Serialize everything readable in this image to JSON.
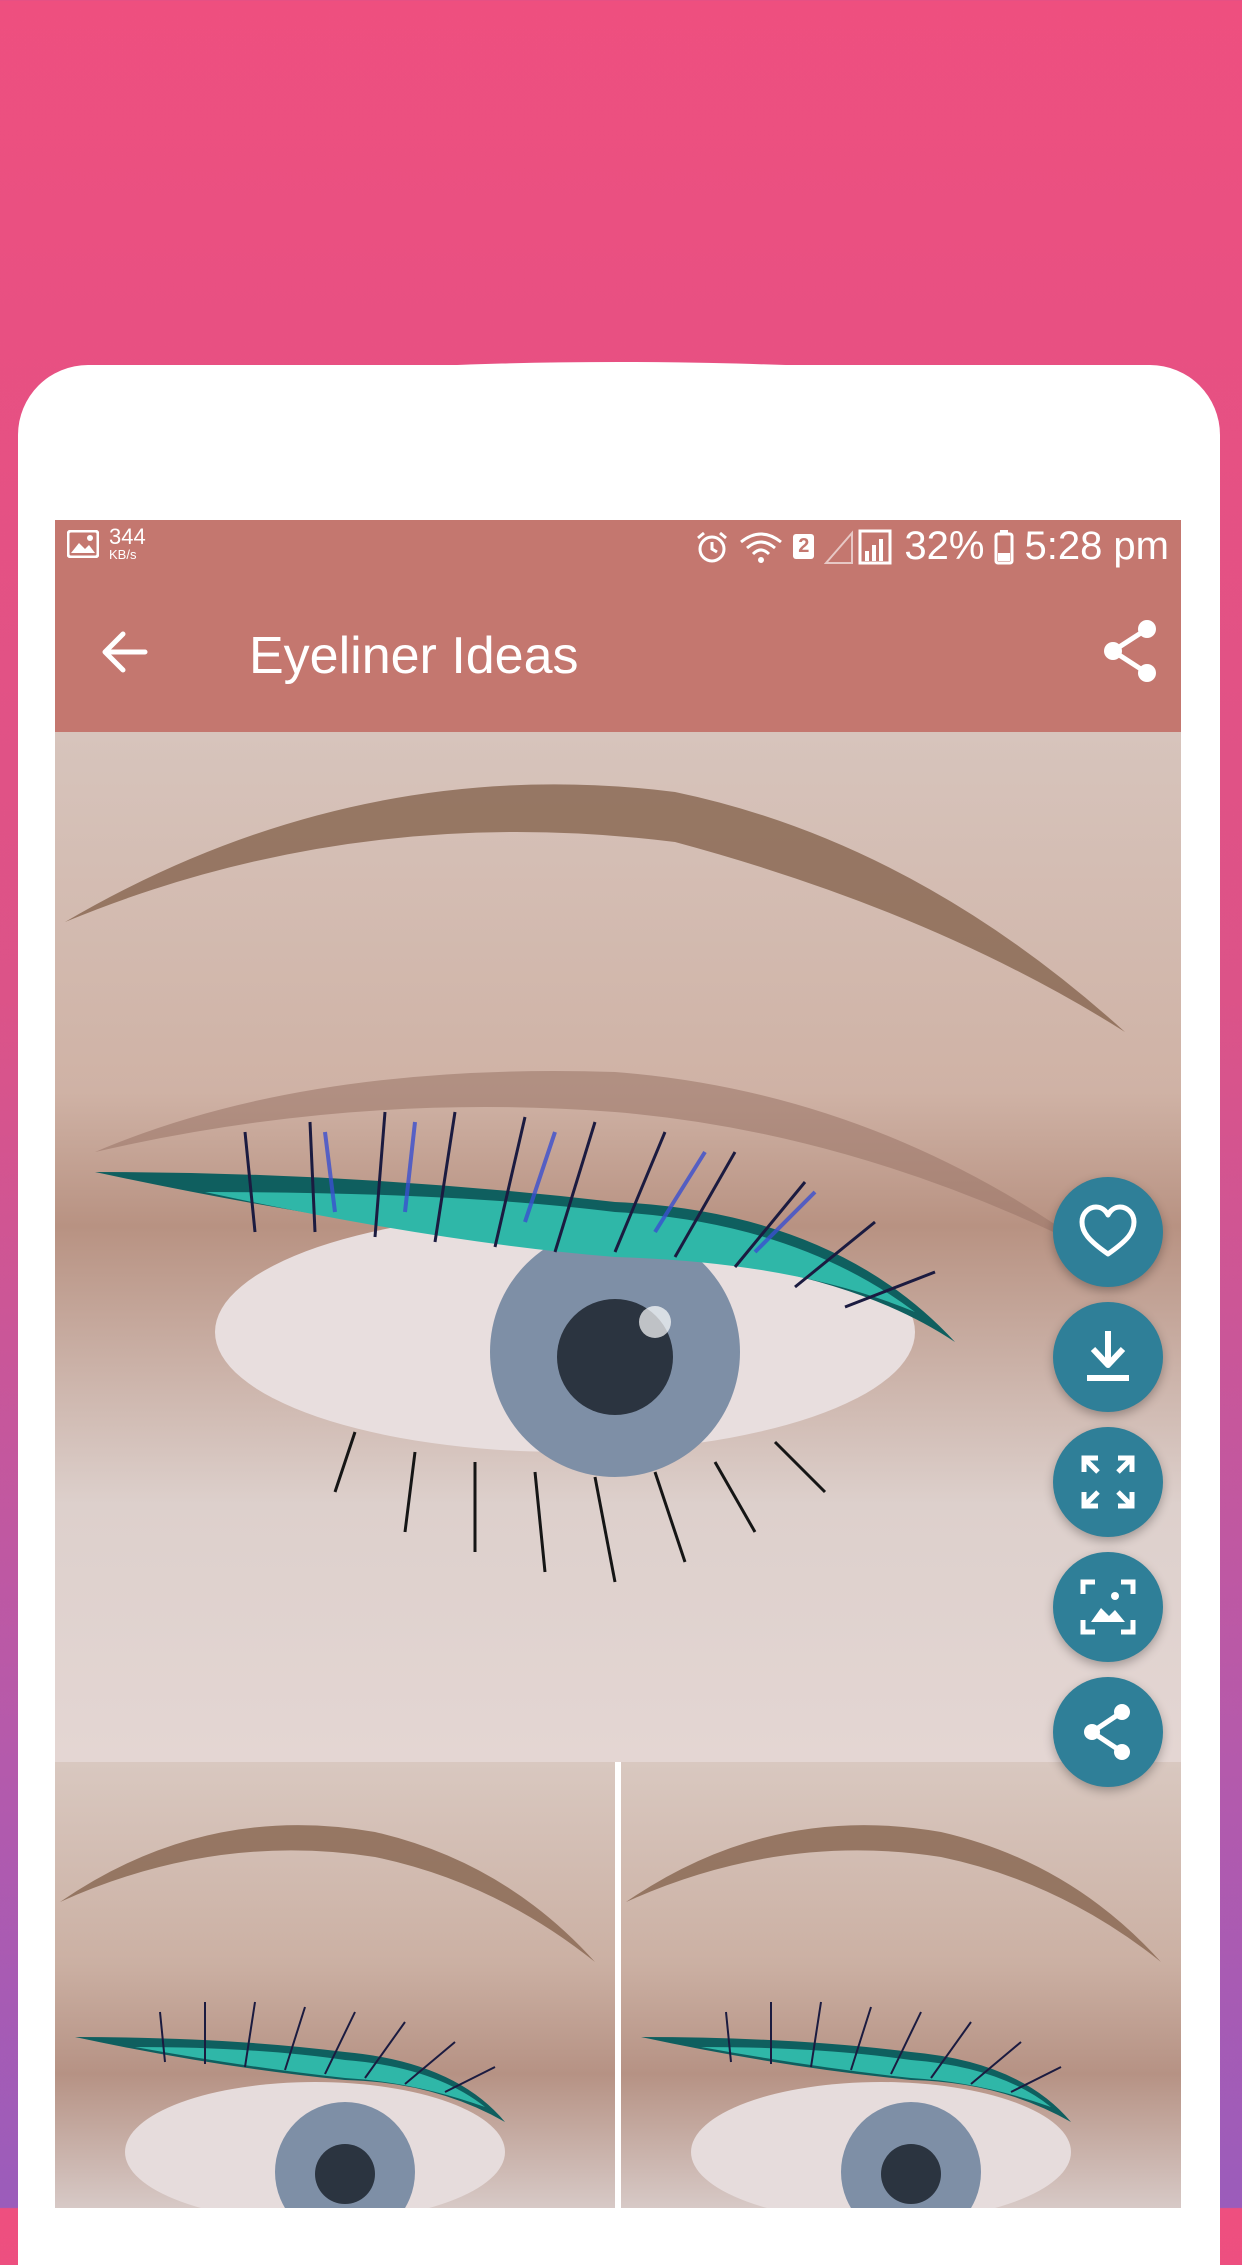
{
  "status_bar": {
    "net_speed": "344",
    "net_unit": "KB/s",
    "sim_slot": "2",
    "battery": "32%",
    "time": "5:28 pm"
  },
  "app_bar": {
    "title": "Eyeliner Ideas"
  },
  "icons": {
    "back": "arrow-left-icon",
    "share": "share-icon",
    "gallery": "image-icon",
    "alarm": "alarm-icon",
    "wifi": "wifi-icon",
    "signal": "signal-icon",
    "battery": "battery-icon",
    "favorite": "heart-icon",
    "download": "download-icon",
    "fullscreen": "fullscreen-icon",
    "set_wallpaper": "set-wallpaper-icon",
    "share_fab": "share-icon"
  },
  "colors": {
    "toolbar": "#c4776f",
    "fab": "#2f7f98",
    "background_top": "#ee4f7f",
    "background_bottom": "#9b5cbb"
  }
}
